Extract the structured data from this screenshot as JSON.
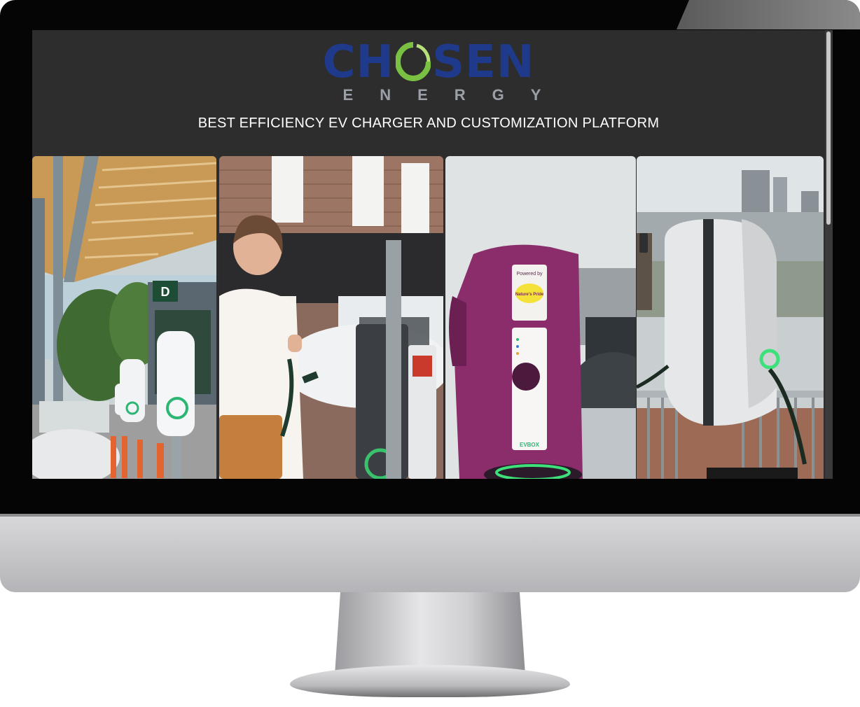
{
  "brand": {
    "logo_word_a": "CH",
    "logo_word_b": "SEN",
    "logo_sub": "ENERGY"
  },
  "hero": {
    "tagline": "BEST EFFICIENCY EV CHARGER AND CUSTOMIZATION PLATFORM"
  },
  "gallery": [
    {
      "name": "station-canopy-photo",
      "sign_text": "D"
    },
    {
      "name": "woman-charging-photo"
    },
    {
      "name": "purple-charger-photo",
      "sign_brand": "EVBOX",
      "sign_powered": "Powered by",
      "sign_logo": "Nature's Pride"
    },
    {
      "name": "wall-charger-city-photo"
    }
  ],
  "colors": {
    "screen_bg": "#2d2d2d",
    "logo_blue": "#1f3a8a",
    "logo_green": "#7ac143",
    "logo_gray": "#9aa0a6"
  }
}
